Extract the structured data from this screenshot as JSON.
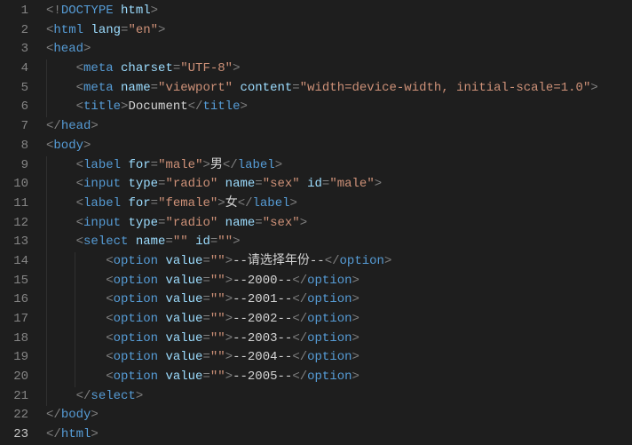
{
  "editor": {
    "active_line": 23,
    "lines": [
      {
        "n": 1,
        "indent": 0,
        "guides": [],
        "tokens": [
          [
            "p",
            "<!"
          ],
          [
            "dt",
            "DOCTYPE"
          ],
          [
            "tx",
            " "
          ],
          [
            "at",
            "html"
          ],
          [
            "p",
            ">"
          ]
        ]
      },
      {
        "n": 2,
        "indent": 0,
        "guides": [],
        "tokens": [
          [
            "p",
            "<"
          ],
          [
            "tg",
            "html"
          ],
          [
            "tx",
            " "
          ],
          [
            "at",
            "lang"
          ],
          [
            "p",
            "="
          ],
          [
            "st",
            "\"en\""
          ],
          [
            "p",
            ">"
          ]
        ]
      },
      {
        "n": 3,
        "indent": 0,
        "guides": [],
        "tokens": [
          [
            "p",
            "<"
          ],
          [
            "tg",
            "head"
          ],
          [
            "p",
            ">"
          ]
        ]
      },
      {
        "n": 4,
        "indent": 1,
        "guides": [
          0
        ],
        "tokens": [
          [
            "p",
            "<"
          ],
          [
            "tg",
            "meta"
          ],
          [
            "tx",
            " "
          ],
          [
            "at",
            "charset"
          ],
          [
            "p",
            "="
          ],
          [
            "st",
            "\"UTF-8\""
          ],
          [
            "p",
            ">"
          ]
        ]
      },
      {
        "n": 5,
        "indent": 1,
        "guides": [
          0
        ],
        "tokens": [
          [
            "p",
            "<"
          ],
          [
            "tg",
            "meta"
          ],
          [
            "tx",
            " "
          ],
          [
            "at",
            "name"
          ],
          [
            "p",
            "="
          ],
          [
            "st",
            "\"viewport\""
          ],
          [
            "tx",
            " "
          ],
          [
            "at",
            "content"
          ],
          [
            "p",
            "="
          ],
          [
            "st",
            "\"width=device-width, initial-scale=1.0\""
          ],
          [
            "p",
            ">"
          ]
        ]
      },
      {
        "n": 6,
        "indent": 1,
        "guides": [
          0
        ],
        "tokens": [
          [
            "p",
            "<"
          ],
          [
            "tg",
            "title"
          ],
          [
            "p",
            ">"
          ],
          [
            "tx",
            "Document"
          ],
          [
            "p",
            "</"
          ],
          [
            "tg",
            "title"
          ],
          [
            "p",
            ">"
          ]
        ]
      },
      {
        "n": 7,
        "indent": 0,
        "guides": [],
        "tokens": [
          [
            "p",
            "</"
          ],
          [
            "tg",
            "head"
          ],
          [
            "p",
            ">"
          ]
        ]
      },
      {
        "n": 8,
        "indent": 0,
        "guides": [],
        "tokens": [
          [
            "p",
            "<"
          ],
          [
            "tg",
            "body"
          ],
          [
            "p",
            ">"
          ]
        ]
      },
      {
        "n": 9,
        "indent": 1,
        "guides": [
          0
        ],
        "tokens": [
          [
            "p",
            "<"
          ],
          [
            "tg",
            "label"
          ],
          [
            "tx",
            " "
          ],
          [
            "at",
            "for"
          ],
          [
            "p",
            "="
          ],
          [
            "st",
            "\"male\""
          ],
          [
            "p",
            ">"
          ],
          [
            "tx",
            "男"
          ],
          [
            "p",
            "</"
          ],
          [
            "tg",
            "label"
          ],
          [
            "p",
            ">"
          ]
        ]
      },
      {
        "n": 10,
        "indent": 1,
        "guides": [
          0
        ],
        "tokens": [
          [
            "p",
            "<"
          ],
          [
            "tg",
            "input"
          ],
          [
            "tx",
            " "
          ],
          [
            "at",
            "type"
          ],
          [
            "p",
            "="
          ],
          [
            "st",
            "\"radio\""
          ],
          [
            "tx",
            " "
          ],
          [
            "at",
            "name"
          ],
          [
            "p",
            "="
          ],
          [
            "st",
            "\"sex\""
          ],
          [
            "tx",
            " "
          ],
          [
            "at",
            "id"
          ],
          [
            "p",
            "="
          ],
          [
            "st",
            "\"male\""
          ],
          [
            "p",
            ">"
          ]
        ]
      },
      {
        "n": 11,
        "indent": 1,
        "guides": [
          0
        ],
        "tokens": [
          [
            "p",
            "<"
          ],
          [
            "tg",
            "label"
          ],
          [
            "tx",
            " "
          ],
          [
            "at",
            "for"
          ],
          [
            "p",
            "="
          ],
          [
            "st",
            "\"female\""
          ],
          [
            "p",
            ">"
          ],
          [
            "tx",
            "女"
          ],
          [
            "p",
            "</"
          ],
          [
            "tg",
            "label"
          ],
          [
            "p",
            ">"
          ]
        ]
      },
      {
        "n": 12,
        "indent": 1,
        "guides": [
          0
        ],
        "tokens": [
          [
            "p",
            "<"
          ],
          [
            "tg",
            "input"
          ],
          [
            "tx",
            " "
          ],
          [
            "at",
            "type"
          ],
          [
            "p",
            "="
          ],
          [
            "st",
            "\"radio\""
          ],
          [
            "tx",
            " "
          ],
          [
            "at",
            "name"
          ],
          [
            "p",
            "="
          ],
          [
            "st",
            "\"sex\""
          ],
          [
            "p",
            ">"
          ]
        ]
      },
      {
        "n": 13,
        "indent": 1,
        "guides": [
          0
        ],
        "tokens": [
          [
            "p",
            "<"
          ],
          [
            "tg",
            "select"
          ],
          [
            "tx",
            " "
          ],
          [
            "at",
            "name"
          ],
          [
            "p",
            "="
          ],
          [
            "st",
            "\"\""
          ],
          [
            "tx",
            " "
          ],
          [
            "at",
            "id"
          ],
          [
            "p",
            "="
          ],
          [
            "st",
            "\"\""
          ],
          [
            "p",
            ">"
          ]
        ]
      },
      {
        "n": 14,
        "indent": 2,
        "guides": [
          0,
          1
        ],
        "tokens": [
          [
            "p",
            "<"
          ],
          [
            "tg",
            "option"
          ],
          [
            "tx",
            " "
          ],
          [
            "at",
            "value"
          ],
          [
            "p",
            "="
          ],
          [
            "st",
            "\"\""
          ],
          [
            "p",
            ">"
          ],
          [
            "tx",
            "--请选择年份--"
          ],
          [
            "p",
            "</"
          ],
          [
            "tg",
            "option"
          ],
          [
            "p",
            ">"
          ]
        ]
      },
      {
        "n": 15,
        "indent": 2,
        "guides": [
          0,
          1
        ],
        "tokens": [
          [
            "p",
            "<"
          ],
          [
            "tg",
            "option"
          ],
          [
            "tx",
            " "
          ],
          [
            "at",
            "value"
          ],
          [
            "p",
            "="
          ],
          [
            "st",
            "\"\""
          ],
          [
            "p",
            ">"
          ],
          [
            "tx",
            "--2000--"
          ],
          [
            "p",
            "</"
          ],
          [
            "tg",
            "option"
          ],
          [
            "p",
            ">"
          ]
        ]
      },
      {
        "n": 16,
        "indent": 2,
        "guides": [
          0,
          1
        ],
        "tokens": [
          [
            "p",
            "<"
          ],
          [
            "tg",
            "option"
          ],
          [
            "tx",
            " "
          ],
          [
            "at",
            "value"
          ],
          [
            "p",
            "="
          ],
          [
            "st",
            "\"\""
          ],
          [
            "p",
            ">"
          ],
          [
            "tx",
            "--2001--"
          ],
          [
            "p",
            "</"
          ],
          [
            "tg",
            "option"
          ],
          [
            "p",
            ">"
          ]
        ]
      },
      {
        "n": 17,
        "indent": 2,
        "guides": [
          0,
          1
        ],
        "tokens": [
          [
            "p",
            "<"
          ],
          [
            "tg",
            "option"
          ],
          [
            "tx",
            " "
          ],
          [
            "at",
            "value"
          ],
          [
            "p",
            "="
          ],
          [
            "st",
            "\"\""
          ],
          [
            "p",
            ">"
          ],
          [
            "tx",
            "--2002--"
          ],
          [
            "p",
            "</"
          ],
          [
            "tg",
            "option"
          ],
          [
            "p",
            ">"
          ]
        ]
      },
      {
        "n": 18,
        "indent": 2,
        "guides": [
          0,
          1
        ],
        "tokens": [
          [
            "p",
            "<"
          ],
          [
            "tg",
            "option"
          ],
          [
            "tx",
            " "
          ],
          [
            "at",
            "value"
          ],
          [
            "p",
            "="
          ],
          [
            "st",
            "\"\""
          ],
          [
            "p",
            ">"
          ],
          [
            "tx",
            "--2003--"
          ],
          [
            "p",
            "</"
          ],
          [
            "tg",
            "option"
          ],
          [
            "p",
            ">"
          ]
        ]
      },
      {
        "n": 19,
        "indent": 2,
        "guides": [
          0,
          1
        ],
        "tokens": [
          [
            "p",
            "<"
          ],
          [
            "tg",
            "option"
          ],
          [
            "tx",
            " "
          ],
          [
            "at",
            "value"
          ],
          [
            "p",
            "="
          ],
          [
            "st",
            "\"\""
          ],
          [
            "p",
            ">"
          ],
          [
            "tx",
            "--2004--"
          ],
          [
            "p",
            "</"
          ],
          [
            "tg",
            "option"
          ],
          [
            "p",
            ">"
          ]
        ]
      },
      {
        "n": 20,
        "indent": 2,
        "guides": [
          0,
          1
        ],
        "tokens": [
          [
            "p",
            "<"
          ],
          [
            "tg",
            "option"
          ],
          [
            "tx",
            " "
          ],
          [
            "at",
            "value"
          ],
          [
            "p",
            "="
          ],
          [
            "st",
            "\"\""
          ],
          [
            "p",
            ">"
          ],
          [
            "tx",
            "--2005--"
          ],
          [
            "p",
            "</"
          ],
          [
            "tg",
            "option"
          ],
          [
            "p",
            ">"
          ]
        ]
      },
      {
        "n": 21,
        "indent": 1,
        "guides": [
          0
        ],
        "tokens": [
          [
            "p",
            "</"
          ],
          [
            "tg",
            "select"
          ],
          [
            "p",
            ">"
          ]
        ]
      },
      {
        "n": 22,
        "indent": 0,
        "guides": [],
        "tokens": [
          [
            "p",
            "</"
          ],
          [
            "tg",
            "body"
          ],
          [
            "p",
            ">"
          ]
        ]
      },
      {
        "n": 23,
        "indent": 0,
        "guides": [],
        "tokens": [
          [
            "p",
            "</"
          ],
          [
            "tg",
            "html"
          ],
          [
            "p",
            ">"
          ]
        ]
      }
    ]
  }
}
